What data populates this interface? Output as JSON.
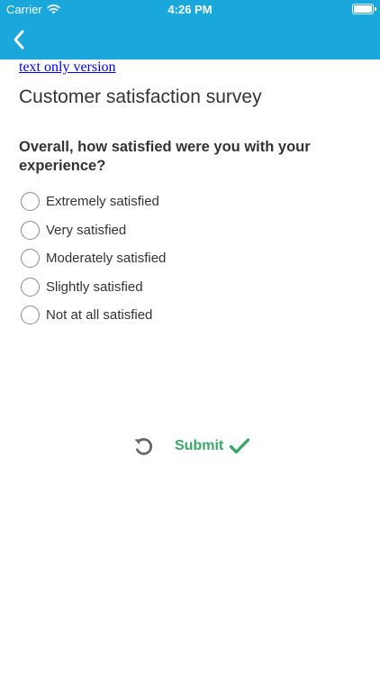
{
  "status_bar": {
    "carrier": "Carrier",
    "time": "4:26 PM"
  },
  "nav": {
    "back_icon": "chevron-left-icon"
  },
  "page": {
    "text_only_link": "text only version",
    "title": "Customer satisfaction survey"
  },
  "question": {
    "text": "Overall, how satisfied were you with your experience?",
    "options": [
      "Extremely satisfied",
      "Very satisfied",
      "Moderately satisfied",
      "Slightly satisfied",
      "Not at all satisfied"
    ]
  },
  "actions": {
    "reset_icon": "undo-icon",
    "submit_label": "Submit",
    "submit_icon": "checkmark-icon"
  },
  "colors": {
    "header": "#1aa7dc",
    "submit": "#3aa769",
    "link": "#0000ee"
  }
}
